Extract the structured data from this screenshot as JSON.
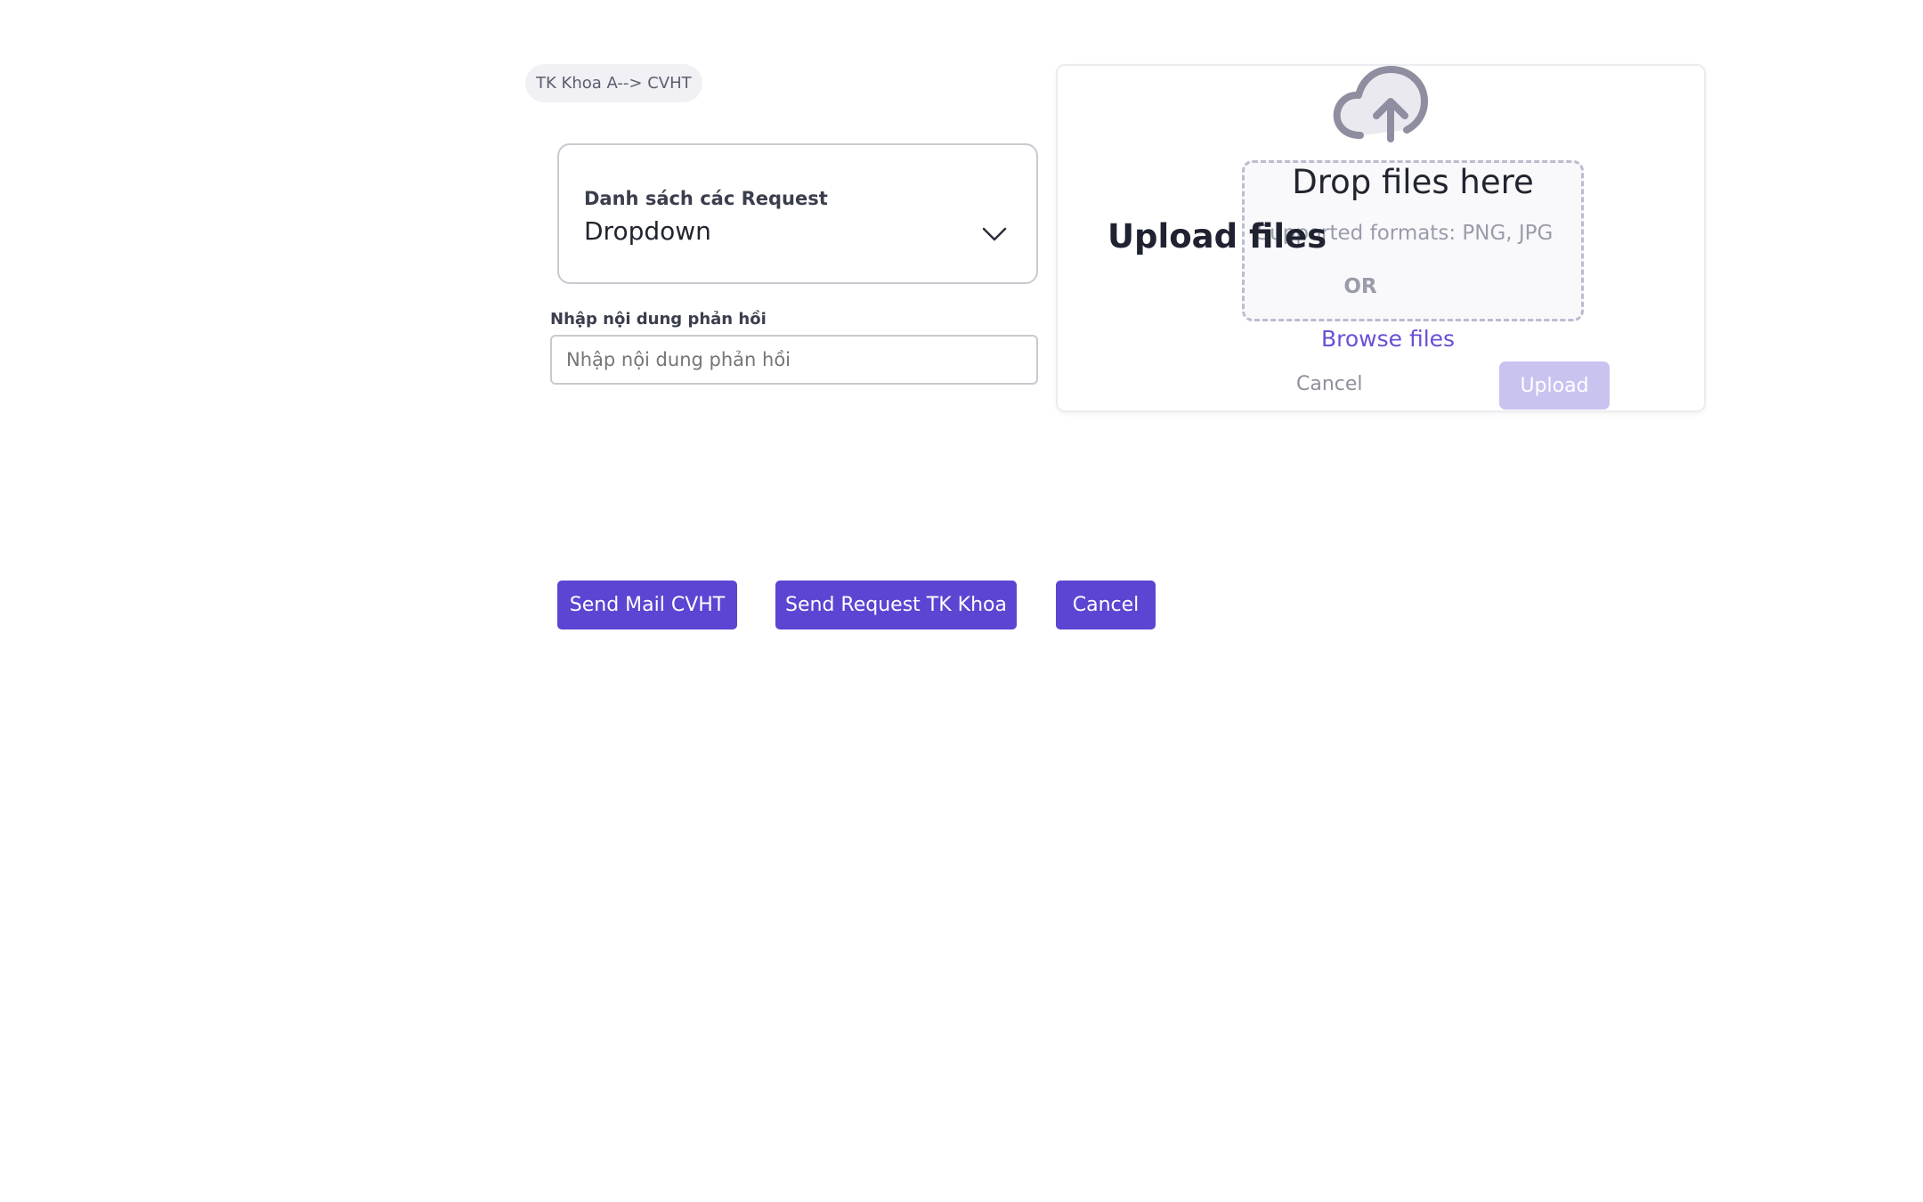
{
  "breadcrumb": {
    "text": "TK Khoa A--> CVHT"
  },
  "dropdown": {
    "label": "Danh sách  các Request",
    "value": "Dropdown",
    "icon": "chevron-down-icon"
  },
  "reply": {
    "label": "Nhập nội dung phản hồi",
    "placeholder": "Nhập nội dung phản hồi"
  },
  "upload": {
    "title": "Upload files",
    "icon": "cloud-upload-icon",
    "drop_title": "Drop files here",
    "formats": "Supported formats: PNG, JPG",
    "or_text": "OR",
    "browse_label": "Browse files",
    "cancel_label": "Cancel",
    "upload_label": "Upload"
  },
  "actions": {
    "send_mail_label": "Send Mail CVHT",
    "send_request_label": "Send Request TK Khoa",
    "cancel_label": "Cancel"
  },
  "colors": {
    "accent": "#5b45d2",
    "accent_disabled": "#c9c3f0",
    "link": "#6a4fd6"
  }
}
